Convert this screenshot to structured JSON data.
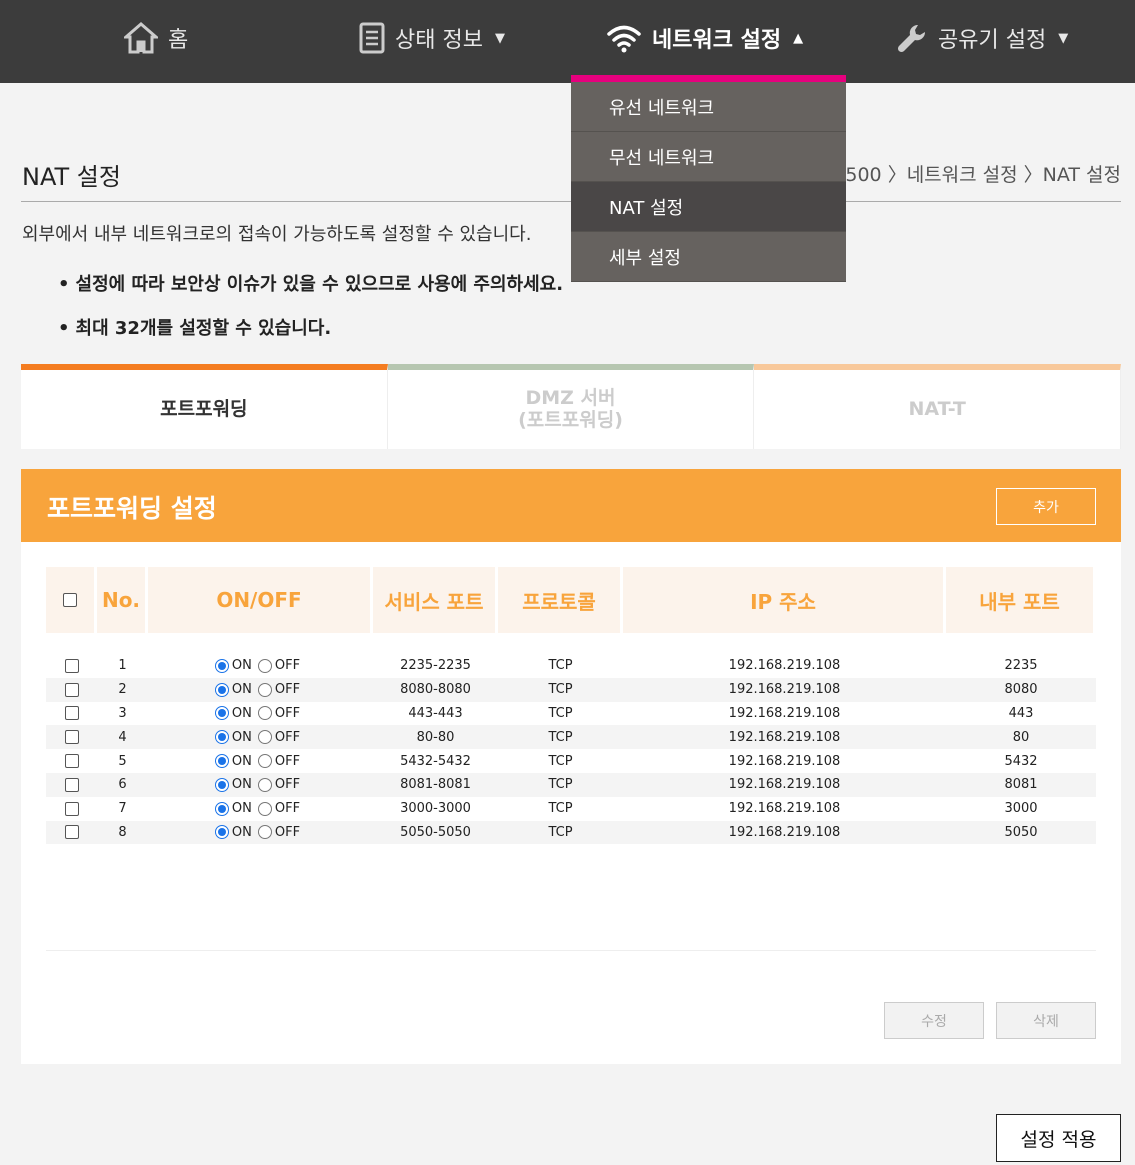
{
  "nav": {
    "home": "홈",
    "status": "상태 정보",
    "network": "네트워크 설정",
    "router": "공유기 설정",
    "caret_down": "▼",
    "caret_up": "▲"
  },
  "dropdown": [
    "유선 네트워크",
    "무선 네트워크",
    "NAT 설정",
    "세부 설정"
  ],
  "page": {
    "title": "NAT 설정",
    "breadcrumb": "M-7500 〉네트워크 설정 〉NAT 설정",
    "description": "외부에서 내부 네트워크로의 접속이 가능하도록 설정할 수 있습니다.",
    "notes": [
      "설정에 따라 보안상 이슈가 있을 수 있으므로 사용에 주의하세요.",
      "최대 32개를 설정할 수 있습니다."
    ]
  },
  "tabs": {
    "t1": "포트포워딩",
    "t2_line1": "DMZ 서버",
    "t2_line2": "(포트포워딩)",
    "t3": "NAT-T"
  },
  "panel": {
    "title": "포트포워딩 설정",
    "add": "추가",
    "edit": "수정",
    "delete": "삭제"
  },
  "table": {
    "headers": {
      "no": "No.",
      "onoff": "ON/OFF",
      "service_port": "서비스 포트",
      "protocol": "프로토콜",
      "ip": "IP 주소",
      "internal_port": "내부 포트"
    },
    "on_label": "ON",
    "off_label": "OFF",
    "rows": [
      {
        "no": "1",
        "service_port": "2235-2235",
        "protocol": "TCP",
        "ip": "192.168.219.108",
        "internal_port": "2235"
      },
      {
        "no": "2",
        "service_port": "8080-8080",
        "protocol": "TCP",
        "ip": "192.168.219.108",
        "internal_port": "8080"
      },
      {
        "no": "3",
        "service_port": "443-443",
        "protocol": "TCP",
        "ip": "192.168.219.108",
        "internal_port": "443"
      },
      {
        "no": "4",
        "service_port": "80-80",
        "protocol": "TCP",
        "ip": "192.168.219.108",
        "internal_port": "80"
      },
      {
        "no": "5",
        "service_port": "5432-5432",
        "protocol": "TCP",
        "ip": "192.168.219.108",
        "internal_port": "5432"
      },
      {
        "no": "6",
        "service_port": "8081-8081",
        "protocol": "TCP",
        "ip": "192.168.219.108",
        "internal_port": "8081"
      },
      {
        "no": "7",
        "service_port": "3000-3000",
        "protocol": "TCP",
        "ip": "192.168.219.108",
        "internal_port": "3000"
      },
      {
        "no": "8",
        "service_port": "5050-5050",
        "protocol": "TCP",
        "ip": "192.168.219.108",
        "internal_port": "5050"
      }
    ]
  },
  "apply": "설정 적용",
  "colors": {
    "accent": "#f8a43c",
    "nav_bg": "#3c3c3c",
    "highlight": "#e6007e",
    "tab1": "#f47c20"
  }
}
